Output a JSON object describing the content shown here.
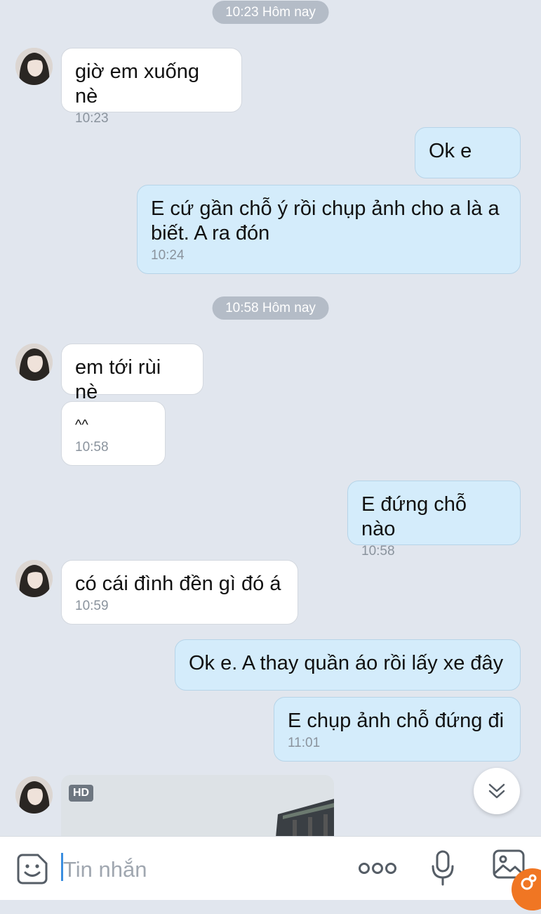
{
  "conversation": {
    "dividers": [
      {
        "label": "10:23 Hôm nay"
      },
      {
        "label": "10:58 Hôm nay"
      }
    ],
    "messages": [
      {
        "text": "giờ em xuống nè",
        "time": "10:23"
      },
      {
        "text": "Ok e"
      },
      {
        "text": "E cứ gần chỗ ý rồi chụp ảnh cho a là a biết. A ra đón",
        "time": "10:24"
      },
      {
        "text": "em tới rùi nè"
      },
      {
        "text": "^^",
        "time": "10:58"
      },
      {
        "text": "E đứng chỗ nào",
        "time": "10:58"
      },
      {
        "text": "có cái đình đền gì đó á",
        "time": "10:59"
      },
      {
        "text": "Ok e. A thay quần áo rồi lấy xe đây"
      },
      {
        "text": "E chụp ảnh chỗ đứng đi",
        "time": "11:01"
      }
    ],
    "image_message": {
      "badge": "HD"
    }
  },
  "composer": {
    "placeholder": "Tin nhắn",
    "icons": {
      "emoji": "smiley-sticker-icon",
      "more": "more-dots-icon",
      "voice": "microphone-icon",
      "gallery": "image-gallery-icon",
      "scroll_down": "double-chevron-down-icon"
    }
  },
  "colors": {
    "background": "#e1e6ee",
    "incoming_bubble": "#ffffff",
    "outgoing_bubble": "#d4ecfb",
    "accent": "#f07623"
  }
}
